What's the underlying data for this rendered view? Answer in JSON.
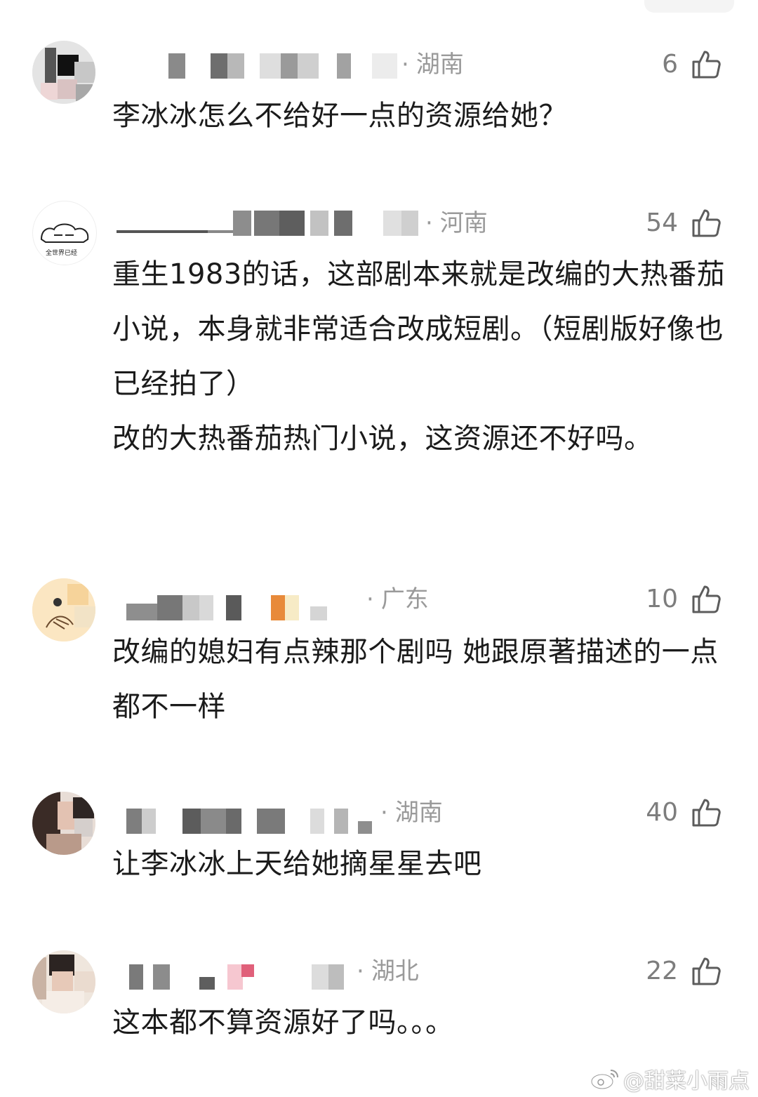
{
  "comments": [
    {
      "location": "湖南",
      "likes": "6",
      "lines": [
        "李冰冰怎么不给好一点的资源给她？"
      ]
    },
    {
      "location": "河南",
      "likes": "54",
      "lines": [
        "重生1983的话，这部剧本来就是改编的大热番茄小说，本身就非常适合改成短剧。（短剧版好像也已经拍了）",
        "改的大热番茄热门小说，这资源还不好吗。"
      ]
    },
    {
      "location": "广东",
      "likes": "10",
      "lines": [
        "改编的媳妇有点辣那个剧吗 她跟原著描述的一点都不一样"
      ]
    },
    {
      "location": "湖南",
      "likes": "40",
      "lines": [
        "让李冰冰上天给她摘星星去吧"
      ]
    },
    {
      "location": "湖北",
      "likes": "22",
      "lines": [
        "这本都不算资源好了吗。。。"
      ]
    }
  ],
  "icons": {
    "like": "thumbs-up-icon",
    "watermark_logo": "weibo-logo-icon"
  },
  "watermark": {
    "text": "@甜菜小雨点"
  },
  "colors": {
    "text": "#1b1b1b",
    "meta": "#9a9a9a",
    "like_count": "#7d7d7d",
    "background": "#ffffff"
  }
}
